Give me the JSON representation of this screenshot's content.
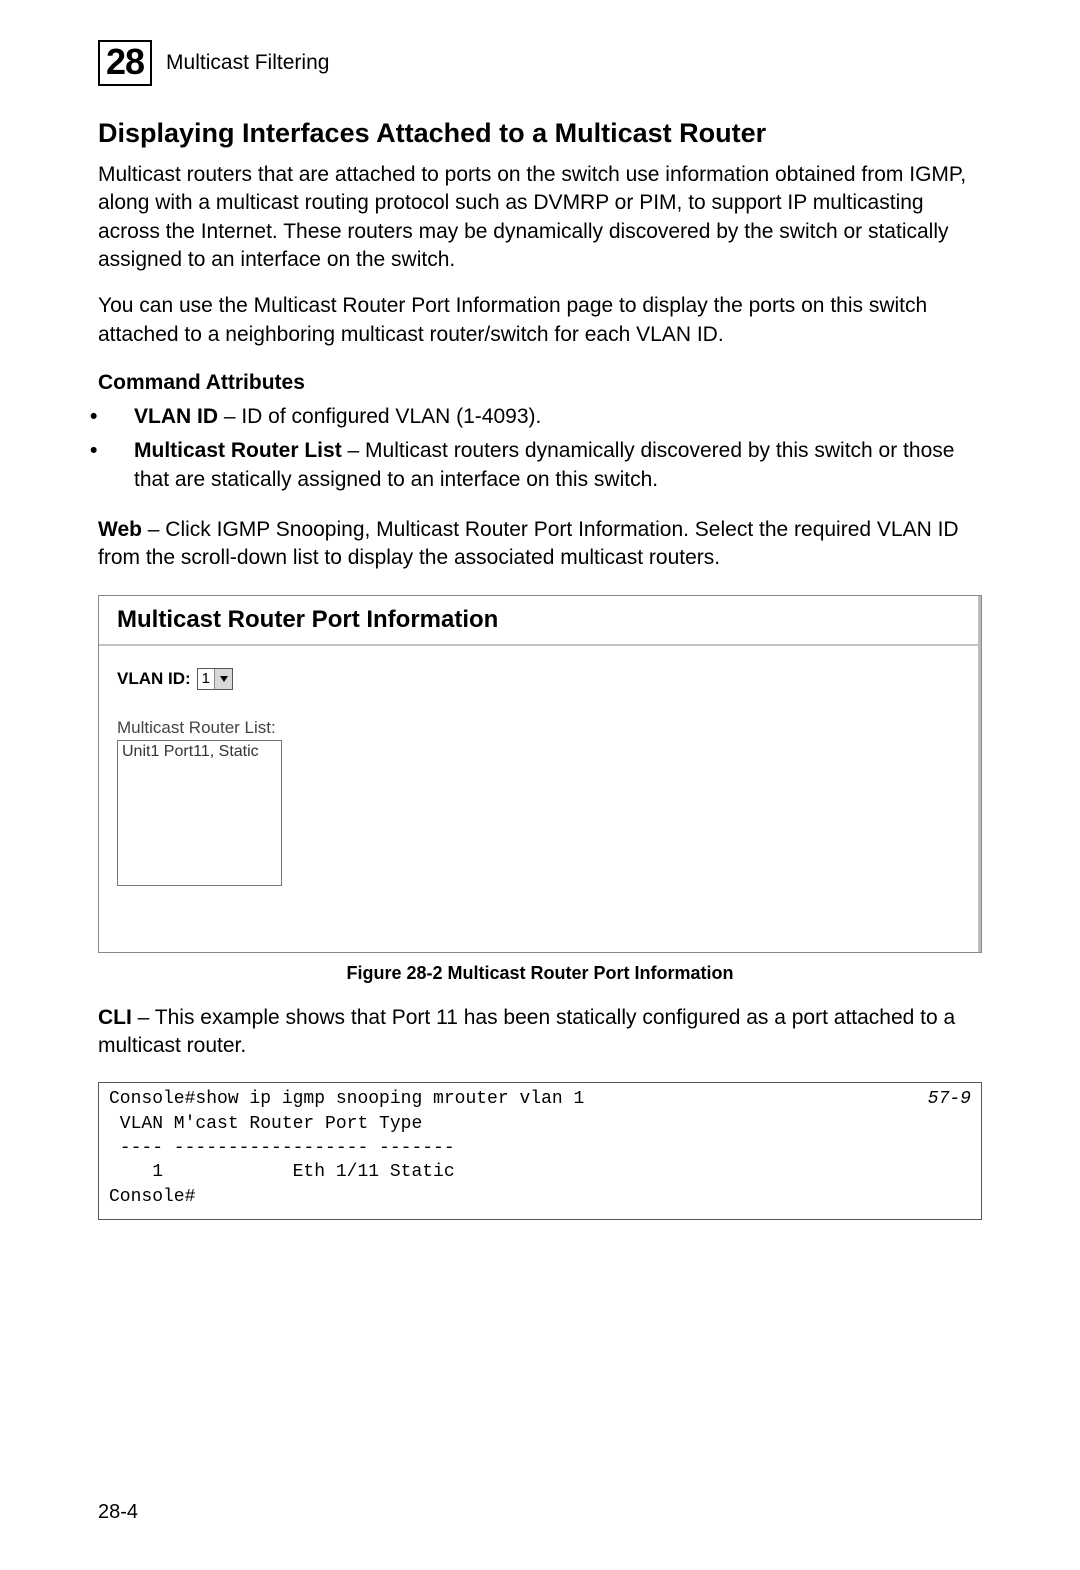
{
  "chapter": {
    "number": "28",
    "label": "Multicast Filtering"
  },
  "section_title": "Displaying Interfaces Attached to a Multicast Router",
  "para1": "Multicast routers that are attached to ports on the switch use information obtained from IGMP, along with a multicast routing protocol such as DVMRP or PIM, to support IP multicasting across the Internet. These routers may be dynamically discovered by the switch or statically assigned to an interface on the switch.",
  "para2": "You can use the Multicast Router Port Information page to display the ports on this switch attached to a neighboring multicast router/switch for each VLAN ID.",
  "command_attr_heading": "Command Attributes",
  "bullets": {
    "b1_bold": "VLAN ID",
    "b1_rest": " – ID of configured VLAN (1-4093).",
    "b2_bold": "Multicast Router List",
    "b2_rest": " – Multicast routers dynamically discovered by this switch or those that are statically assigned to an interface on this switch."
  },
  "web_bold": "Web",
  "web_text": " – Click IGMP Snooping, Multicast Router Port Information. Select the required VLAN ID from the scroll-down list to display the associated multicast routers.",
  "figure": {
    "panel_title": "Multicast Router Port Information",
    "vlan_label": "VLAN ID:",
    "vlan_value": "1",
    "mrlist_label": "Multicast Router List:",
    "mrlist_item": "Unit1 Port11, Static",
    "caption": "Figure 28-2  Multicast Router Port Information"
  },
  "cli_bold": "CLI",
  "cli_intro": " – This example shows that Port 11 has been statically configured as a port attached to a multicast router.",
  "cli_ref": "57-9",
  "cli_text": "Console#show ip igmp snooping mrouter vlan 1\n VLAN M'cast Router Port Type\n ---- ------------------ -------\n    1            Eth 1/11 Static\nConsole#",
  "page_number": "28-4"
}
